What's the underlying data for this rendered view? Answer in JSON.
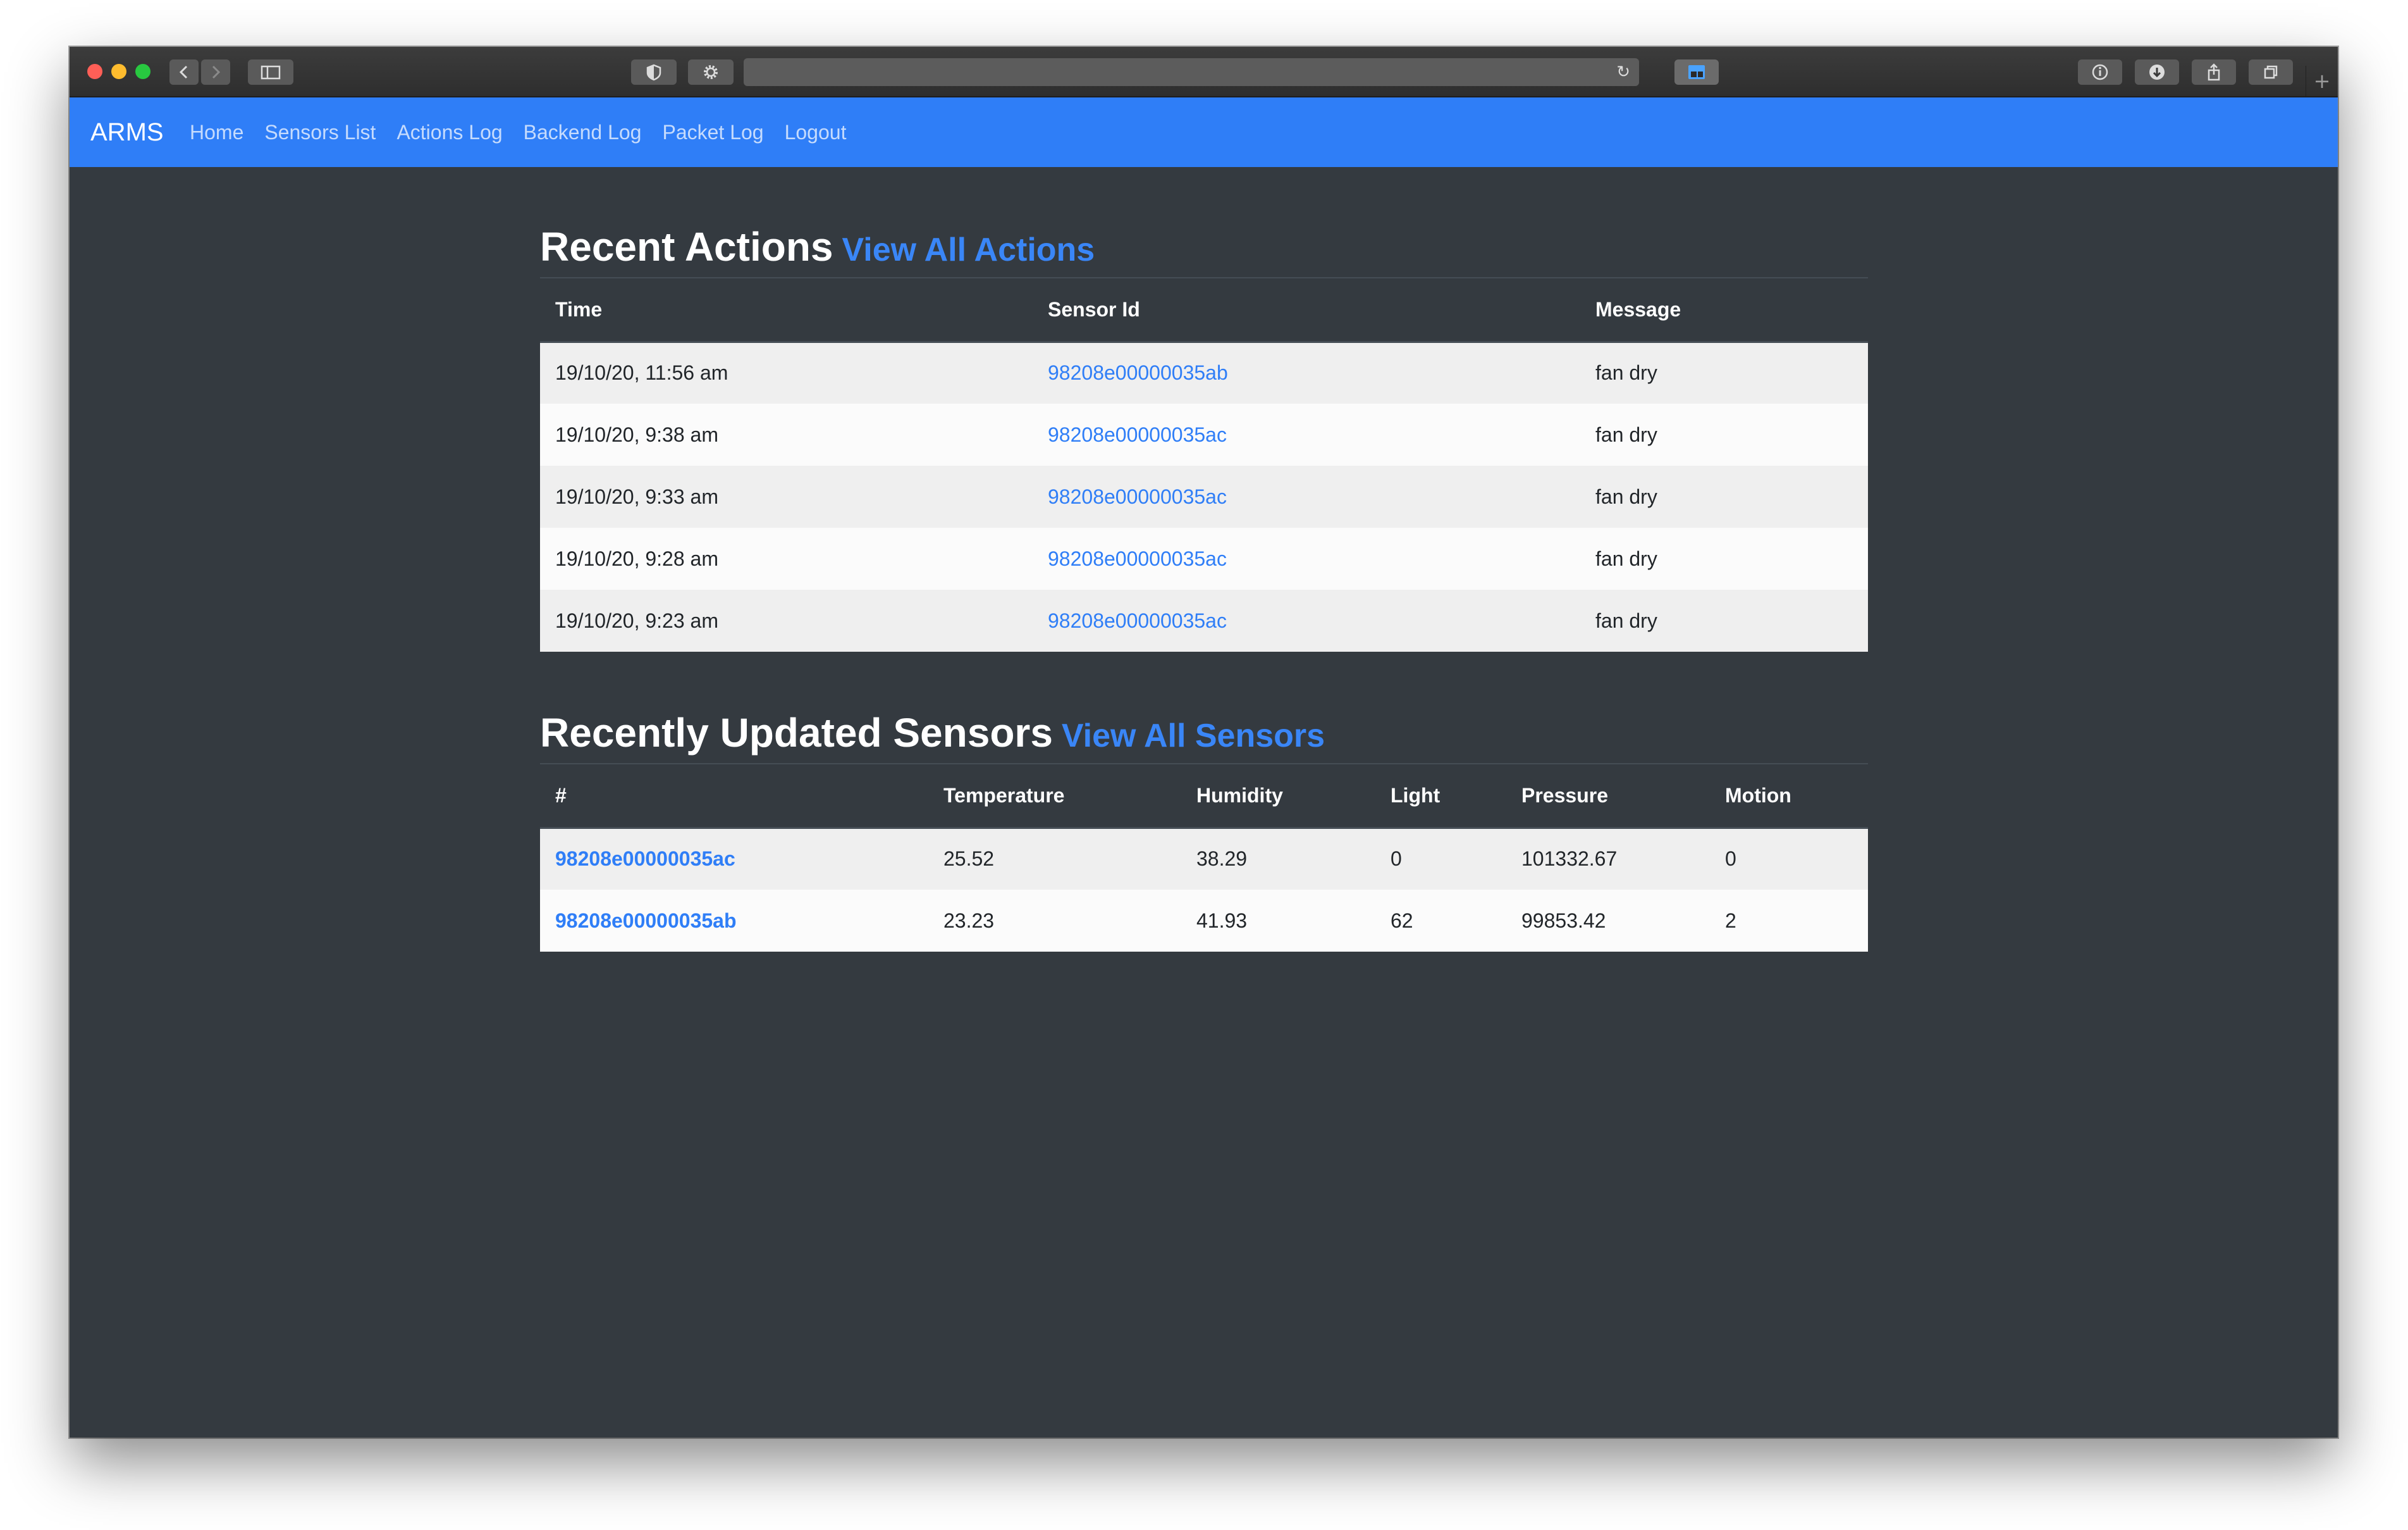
{
  "browser": {
    "icons": [
      "back-icon",
      "forward-icon",
      "sidebar-icon",
      "shield-icon",
      "gear-icon",
      "reload-icon",
      "extension-icon",
      "info-icon",
      "download-icon",
      "share-icon",
      "tabs-icon",
      "new-tab-icon"
    ]
  },
  "nav": {
    "brand": "ARMS",
    "links": [
      "Home",
      "Sensors List",
      "Actions Log",
      "Backend Log",
      "Packet Log",
      "Logout"
    ]
  },
  "actions": {
    "title": "Recent Actions",
    "view_all": "View All Actions",
    "headers": [
      "Time",
      "Sensor Id",
      "Message"
    ],
    "rows": [
      [
        "19/10/20, 11:56 am",
        "98208e00000035ab",
        "fan dry"
      ],
      [
        "19/10/20, 9:38 am",
        "98208e00000035ac",
        "fan dry"
      ],
      [
        "19/10/20, 9:33 am",
        "98208e00000035ac",
        "fan dry"
      ],
      [
        "19/10/20, 9:28 am",
        "98208e00000035ac",
        "fan dry"
      ],
      [
        "19/10/20, 9:23 am",
        "98208e00000035ac",
        "fan dry"
      ]
    ]
  },
  "sensors": {
    "title": "Recently Updated Sensors",
    "view_all": "View All Sensors",
    "headers": [
      "#",
      "Temperature",
      "Humidity",
      "Light",
      "Pressure",
      "Motion"
    ],
    "rows": [
      [
        "98208e00000035ac",
        "25.52",
        "38.29",
        "0",
        "101332.67",
        "0"
      ],
      [
        "98208e00000035ab",
        "23.23",
        "41.93",
        "62",
        "99853.42",
        "2"
      ]
    ]
  },
  "colors": {
    "navbar": "#2f7ef7",
    "background": "#343a40",
    "link": "#2f7ef7"
  }
}
